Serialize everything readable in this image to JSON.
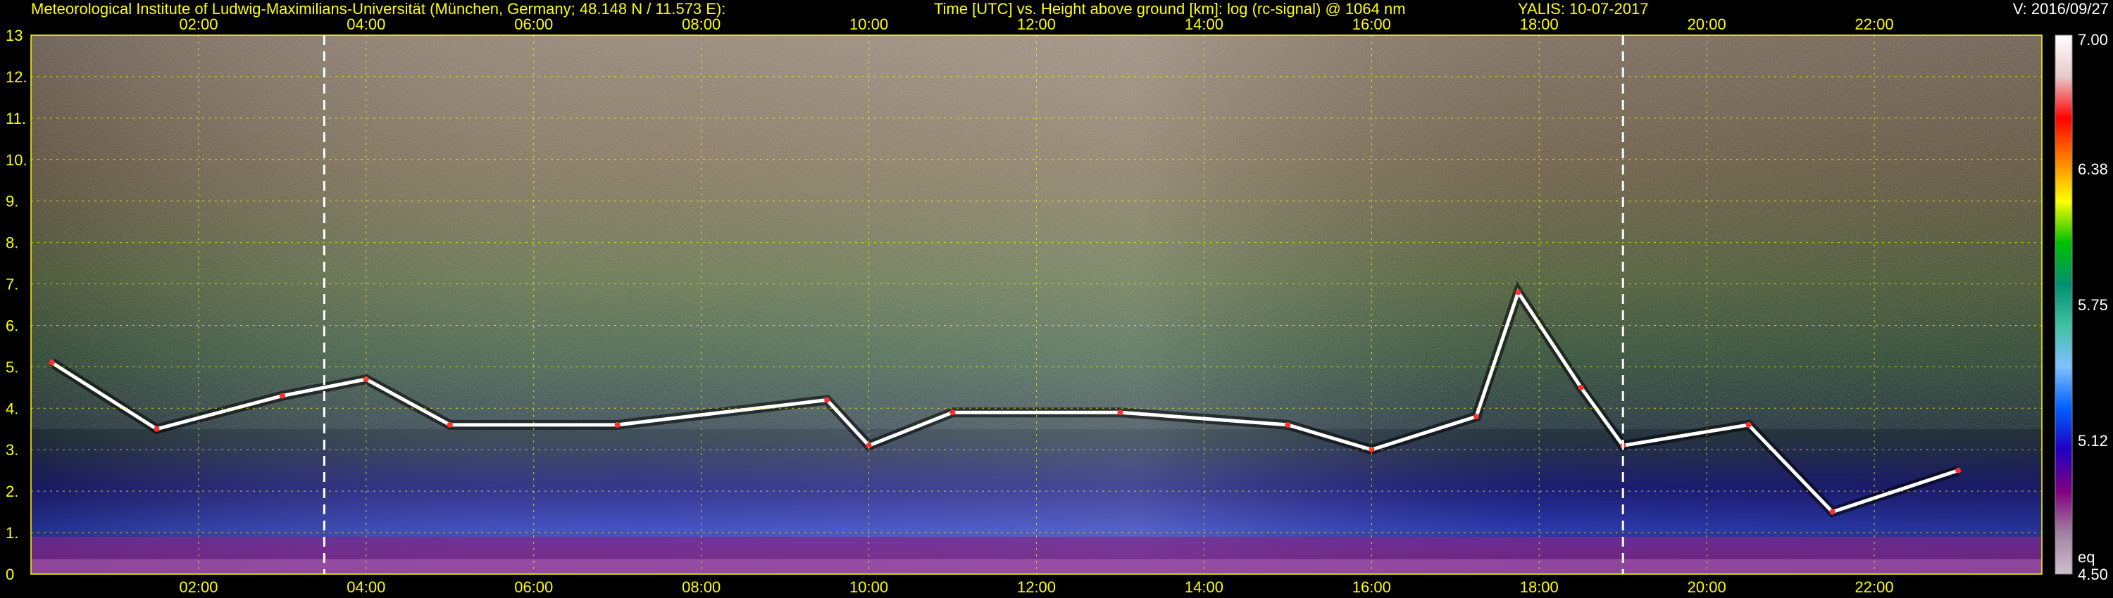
{
  "header": {
    "institute": "Meteorological Institute of Ludwig-Maximilians-Universität (München, Germany; 48.148 N / 11.573 E):",
    "title": "Time [UTC] vs. Height above ground [km]: log (rc-signal) @ 1064 nm",
    "instrument_date": "YALIS: 10-07-2017",
    "version": "V: 2016/09/27"
  },
  "colors": {
    "header_text": "#ffff00",
    "tick_text": "#ffff00",
    "grid": "#ffff00",
    "marker_line": "#ffffff",
    "background": "#000000"
  },
  "chart_data": {
    "type": "heatmap",
    "title": "Time [UTC] vs. Height above ground [km]: log (rc-signal) @ 1064 nm",
    "xlabel": "",
    "ylabel": "",
    "xlim": [
      "00:00",
      "24:00"
    ],
    "ylim": [
      0,
      13
    ],
    "x_ticks": [
      "02:00",
      "04:00",
      "06:00",
      "08:00",
      "10:00",
      "12:00",
      "14:00",
      "16:00",
      "18:00",
      "20:00",
      "22:00"
    ],
    "y_ticks": [
      "0",
      "1.",
      "2.",
      "3.",
      "4.",
      "5.",
      "6.",
      "7.",
      "8.",
      "9.",
      "10.",
      "11.",
      "12.",
      "13"
    ],
    "grid": true,
    "vertical_markers": [
      "03:30",
      "19:00"
    ],
    "colorbar": {
      "range": [
        4.5,
        7.0
      ],
      "labels": [
        "7.00",
        "6.38",
        "5.75",
        "5.12",
        "eq",
        "4.50"
      ],
      "stops": [
        "#ffffff",
        "#e8c8c8",
        "#ff0000",
        "#ff8000",
        "#ffff00",
        "#00c000",
        "#009070",
        "#40c0a0",
        "#80c0ff",
        "#0060ff",
        "#2000c0",
        "#800080",
        "#a080a0",
        "#d0c0d0"
      ]
    },
    "features": {
      "cloud_layer_km": [
        {
          "t": "00:15",
          "h": 5.1
        },
        {
          "t": "01:30",
          "h": 3.5
        },
        {
          "t": "03:00",
          "h": 4.3
        },
        {
          "t": "04:00",
          "h": 4.7
        },
        {
          "t": "05:00",
          "h": 3.6
        },
        {
          "t": "07:00",
          "h": 3.6
        },
        {
          "t": "09:30",
          "h": 4.2
        },
        {
          "t": "10:00",
          "h": 3.1
        },
        {
          "t": "11:00",
          "h": 3.9
        },
        {
          "t": "13:00",
          "h": 3.9
        },
        {
          "t": "15:00",
          "h": 3.6
        },
        {
          "t": "16:00",
          "h": 3.0
        },
        {
          "t": "17:15",
          "h": 3.8
        },
        {
          "t": "17:45",
          "h": 6.8
        },
        {
          "t": "18:30",
          "h": 4.5
        },
        {
          "t": "19:00",
          "h": 3.1
        },
        {
          "t": "20:30",
          "h": 3.6
        },
        {
          "t": "21:30",
          "h": 1.5
        },
        {
          "t": "23:00",
          "h": 2.5
        }
      ],
      "boundary_layer_km": 0.9
    }
  }
}
